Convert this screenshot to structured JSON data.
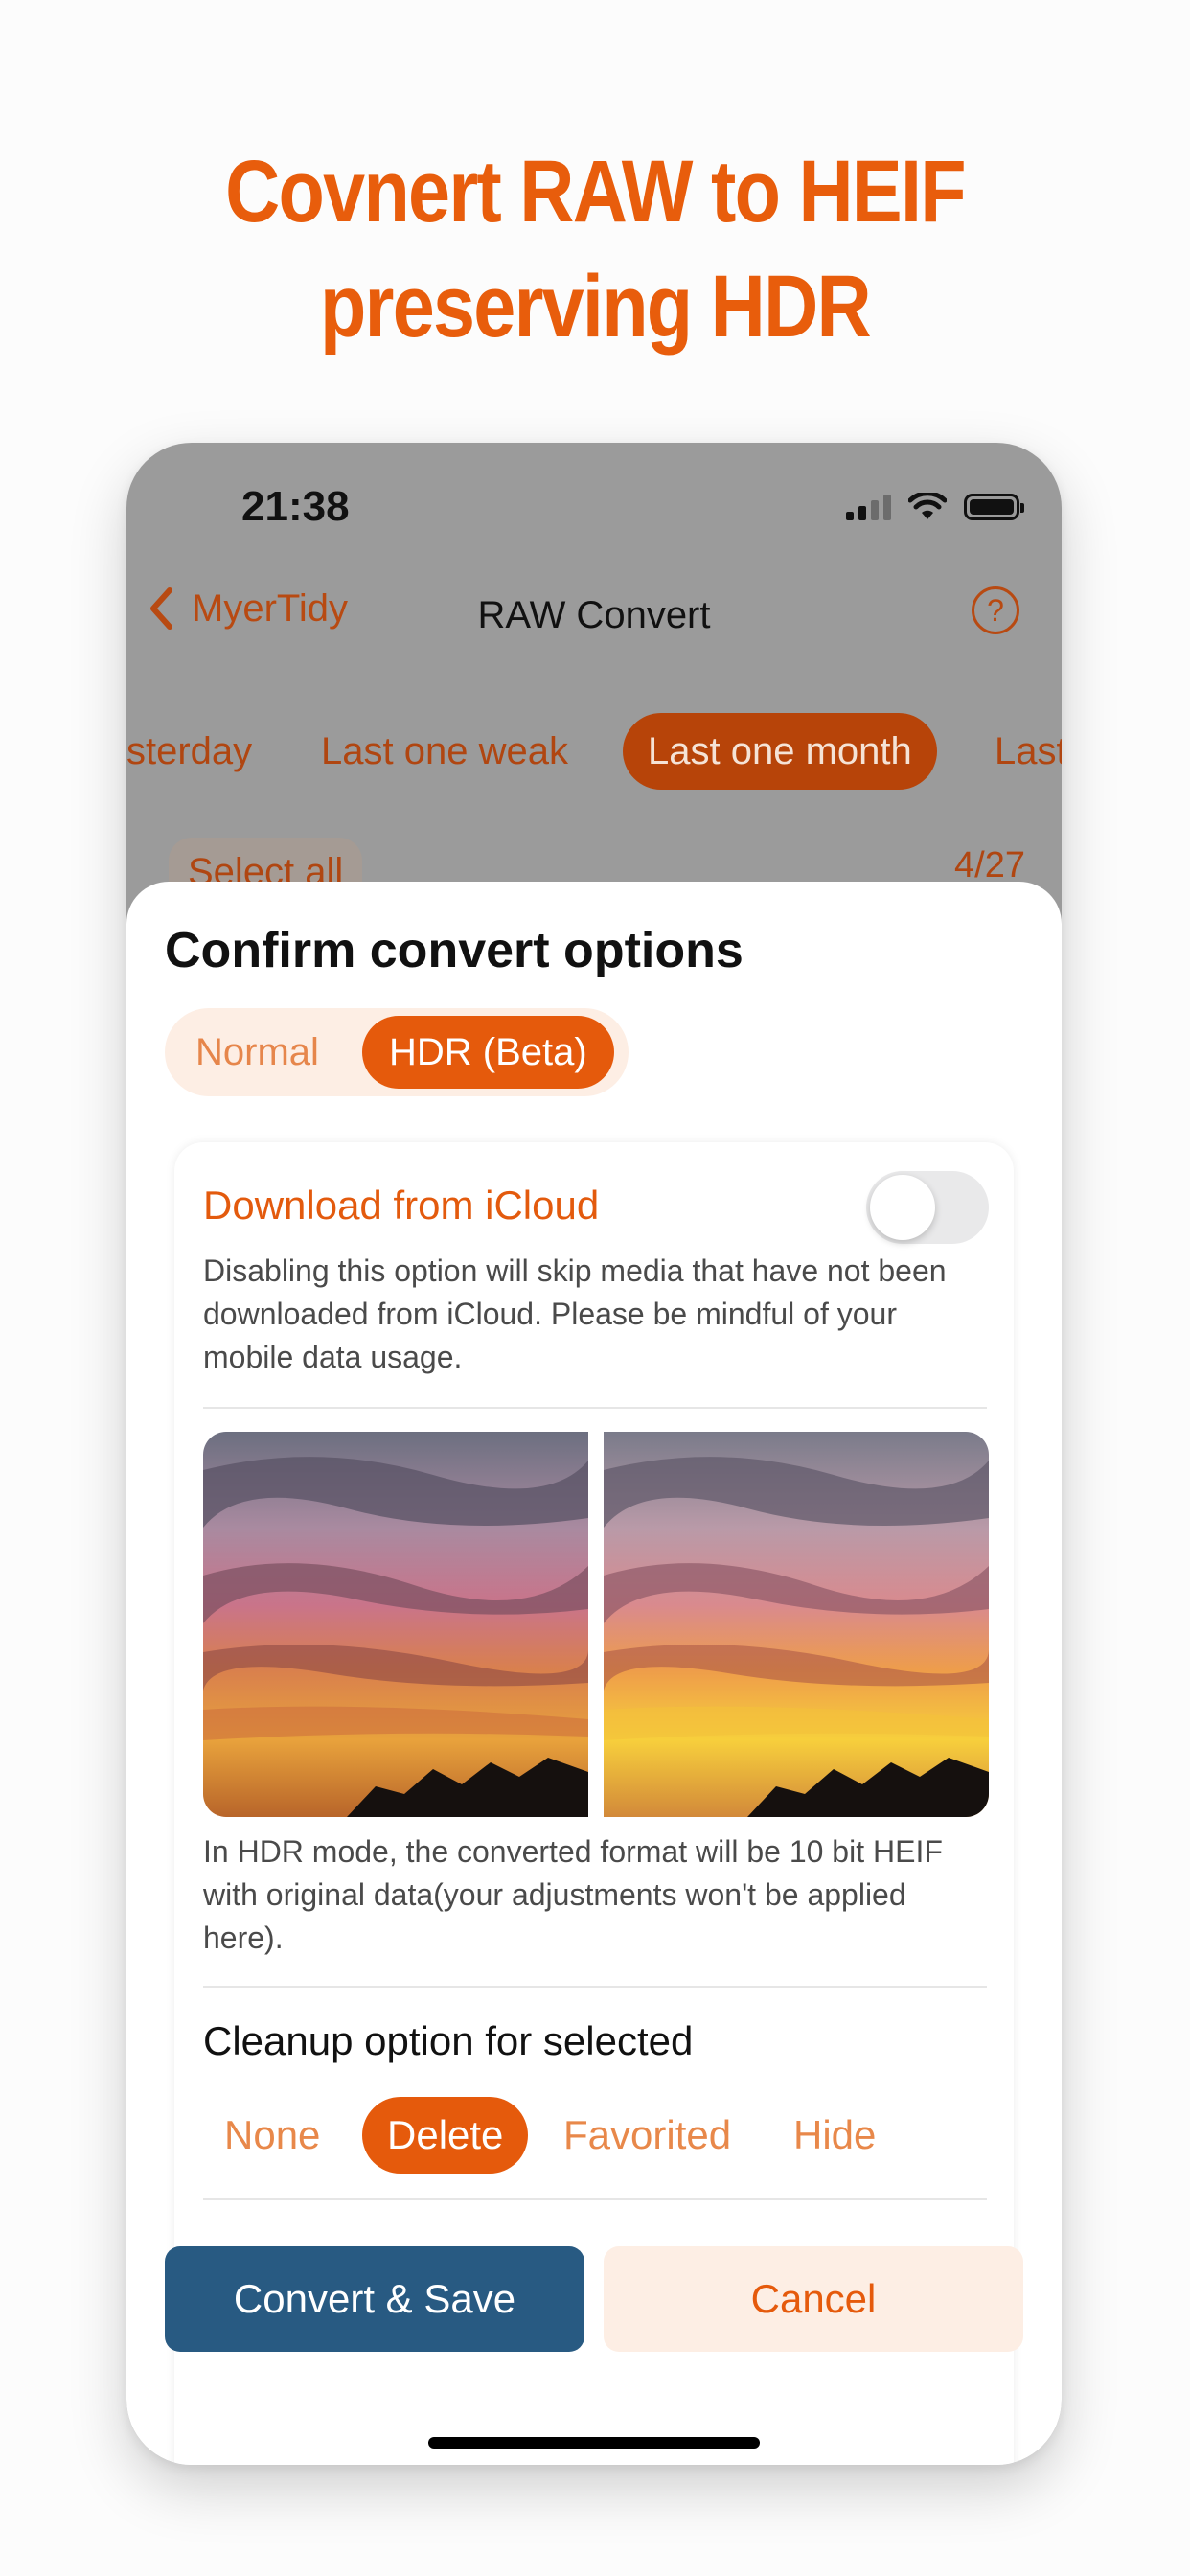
{
  "headline": {
    "line1": "Covnert RAW to HEIF",
    "line2": "preserving HDR"
  },
  "status": {
    "time": "21:38"
  },
  "nav": {
    "back_label": "MyerTidy",
    "title": "RAW Convert",
    "help": "?"
  },
  "filters": [
    {
      "label": "sterday"
    },
    {
      "label": "Last one weak"
    },
    {
      "label": "Last one month",
      "active": true
    },
    {
      "label": "Last"
    }
  ],
  "select_all": "Select all",
  "count": "4/27",
  "sheet": {
    "title": "Confirm convert options",
    "modes": {
      "normal": "Normal",
      "hdr": "HDR (Beta)",
      "selected": "HDR (Beta)"
    },
    "icloud": {
      "label": "Download from iCloud",
      "enabled": false,
      "description": "Disabling this option will skip media that have not been downloaded from iCloud. Please be mindful of your mobile data usage."
    },
    "hdr_note": "In HDR mode, the converted format will be 10 bit HEIF with original data(your adjustments won't be applied here).",
    "cleanup": {
      "title": "Cleanup option for selected",
      "options": [
        "None",
        "Delete",
        "Favorited",
        "Hide"
      ],
      "selected": "Delete"
    },
    "buttons": {
      "convert": "Convert & Save",
      "cancel": "Cancel"
    }
  },
  "colors": {
    "accent": "#e55a0c",
    "primary_button": "#285a82",
    "headline": "#e85d0c"
  }
}
